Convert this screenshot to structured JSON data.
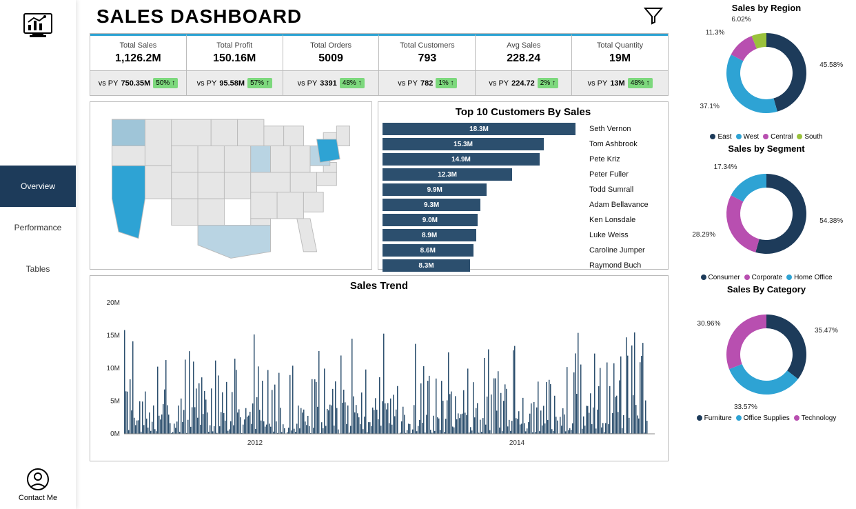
{
  "title": "SALES DASHBOARD",
  "sidebar": {
    "items": [
      {
        "label": "Overview",
        "active": true
      },
      {
        "label": "Performance",
        "active": false
      },
      {
        "label": "Tables",
        "active": false
      }
    ],
    "contact": "Contact Me"
  },
  "kpis": [
    {
      "label": "Total Sales",
      "value": "1,126.2M",
      "py_prefix": "vs PY",
      "py_value": "750.35M",
      "pct": "50%"
    },
    {
      "label": "Total Profit",
      "value": "150.16M",
      "py_prefix": "vs PY",
      "py_value": "95.58M",
      "pct": "57%"
    },
    {
      "label": "Total Orders",
      "value": "5009",
      "py_prefix": "vs PY",
      "py_value": "3391",
      "pct": "48%"
    },
    {
      "label": "Total Customers",
      "value": "793",
      "py_prefix": "vs PY",
      "py_value": "782",
      "pct": "1%"
    },
    {
      "label": "Avg Sales",
      "value": "228.24",
      "py_prefix": "vs PY",
      "py_value": "224.72",
      "pct": "2%"
    },
    {
      "label": "Total Quantity",
      "value": "19M",
      "py_prefix": "vs PY",
      "py_value": "13M",
      "pct": "48%"
    }
  ],
  "customers_title": "Top 10 Customers By Sales",
  "trend_title": "Sales Trend",
  "colors": {
    "darknavy": "#1d3b5a",
    "navy": "#2c4f6e",
    "cyan": "#2ea3d4",
    "magenta": "#b84fb0",
    "green": "#9ac23c"
  },
  "donuts": {
    "region": {
      "title": "Sales by Region",
      "legend": [
        {
          "name": "East",
          "color": "#1d3b5a"
        },
        {
          "name": "West",
          "color": "#2ea3d4"
        },
        {
          "name": "Central",
          "color": "#b84fb0"
        },
        {
          "name": "South",
          "color": "#9ac23c"
        }
      ]
    },
    "segment": {
      "title": "Sales by Segment",
      "legend": [
        {
          "name": "Consumer",
          "color": "#1d3b5a"
        },
        {
          "name": "Corporate",
          "color": "#b84fb0"
        },
        {
          "name": "Home Office",
          "color": "#2ea3d4"
        }
      ]
    },
    "category": {
      "title": "Sales By Category",
      "legend": [
        {
          "name": "Furniture",
          "color": "#1d3b5a"
        },
        {
          "name": "Office Supplies",
          "color": "#2ea3d4"
        },
        {
          "name": "Technology",
          "color": "#b84fb0"
        }
      ]
    }
  },
  "chart_data": [
    {
      "type": "bar",
      "title": "Top 10 Customers By Sales",
      "orientation": "horizontal",
      "categories": [
        "Seth Vernon",
        "Tom Ashbrook",
        "Pete Kriz",
        "Peter Fuller",
        "Todd Sumrall",
        "Adam Bellavance",
        "Ken Lonsdale",
        "Luke Weiss",
        "Caroline Jumper",
        "Raymond Buch"
      ],
      "values": [
        18.3,
        15.3,
        14.9,
        12.3,
        9.9,
        9.3,
        9.0,
        8.9,
        8.6,
        8.3
      ],
      "value_labels": [
        "18.3M",
        "15.3M",
        "14.9M",
        "12.3M",
        "9.9M",
        "9.3M",
        "9.0M",
        "8.9M",
        "8.6M",
        "8.3M"
      ],
      "unit": "M"
    },
    {
      "type": "line",
      "title": "Sales Trend",
      "xlabel": "",
      "ylabel": "",
      "x_ticks": [
        "2012",
        "2014"
      ],
      "y_ticks": [
        "0M",
        "5M",
        "10M",
        "15M",
        "20M"
      ],
      "ylim": [
        0,
        20
      ]
    },
    {
      "type": "pie",
      "title": "Sales by Region",
      "series": [
        {
          "name": "East",
          "value": 45.58,
          "label": "45.58%",
          "color": "#1d3b5a"
        },
        {
          "name": "West",
          "value": 37.1,
          "label": "37.1%",
          "color": "#2ea3d4"
        },
        {
          "name": "Central",
          "value": 11.3,
          "label": "11.3%",
          "color": "#b84fb0"
        },
        {
          "name": "South",
          "value": 6.02,
          "label": "6.02%",
          "color": "#9ac23c"
        }
      ]
    },
    {
      "type": "pie",
      "title": "Sales by Segment",
      "series": [
        {
          "name": "Consumer",
          "value": 54.38,
          "label": "54.38%",
          "color": "#1d3b5a"
        },
        {
          "name": "Corporate",
          "value": 28.29,
          "label": "28.29%",
          "color": "#b84fb0"
        },
        {
          "name": "Home Office",
          "value": 17.34,
          "label": "17.34%",
          "color": "#2ea3d4"
        }
      ]
    },
    {
      "type": "pie",
      "title": "Sales By Category",
      "series": [
        {
          "name": "Furniture",
          "value": 35.47,
          "label": "35.47%",
          "color": "#1d3b5a"
        },
        {
          "name": "Office Supplies",
          "value": 33.57,
          "label": "33.57%",
          "color": "#2ea3d4"
        },
        {
          "name": "Technology",
          "value": 30.96,
          "label": "30.96%",
          "color": "#b84fb0"
        }
      ]
    }
  ]
}
